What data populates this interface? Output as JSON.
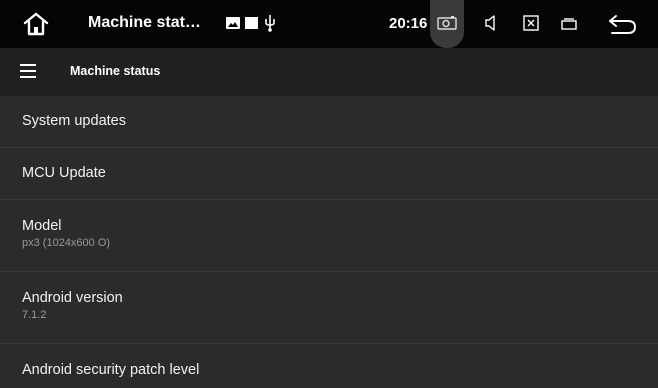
{
  "status_bar": {
    "app_title": "Machine stat…",
    "time": "20:16"
  },
  "toolbar": {
    "title": "Machine status"
  },
  "settings": [
    {
      "label": "System updates"
    },
    {
      "label": "MCU Update"
    },
    {
      "label": "Model",
      "value": "px3 (1024x600 O)"
    },
    {
      "label": "Android version",
      "value": "7.1.2"
    },
    {
      "label": "Android security patch level"
    }
  ],
  "icons": {
    "home": "home-icon",
    "notif_image": "image-icon",
    "notif_square": "square-icon",
    "notif_usb": "usb-icon",
    "camera": "camera-icon",
    "volume": "volume-icon",
    "close_app": "close-window-icon",
    "recents": "recents-icon",
    "back": "back-icon",
    "menu": "hamburger-menu-icon"
  }
}
